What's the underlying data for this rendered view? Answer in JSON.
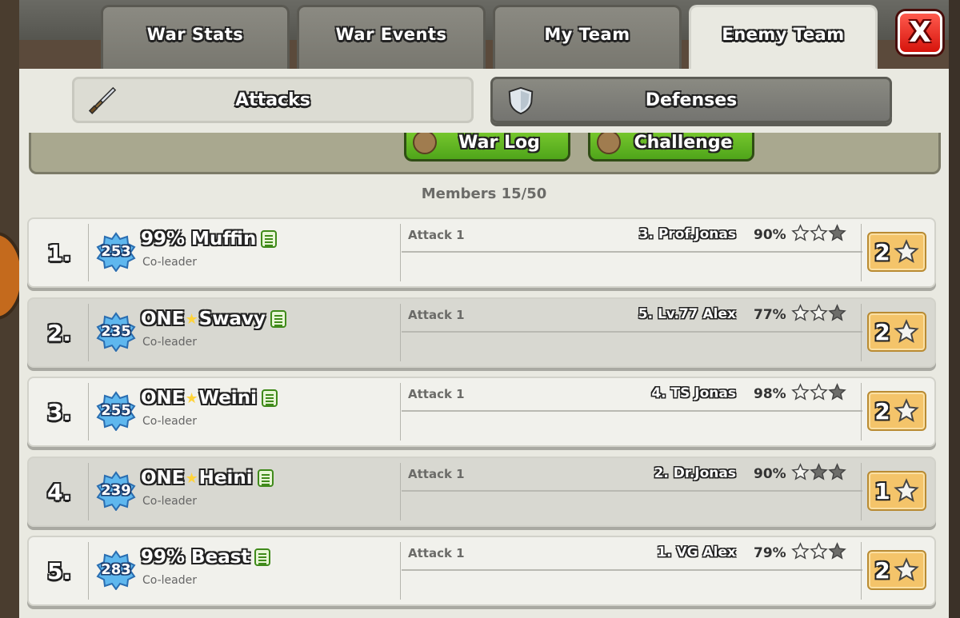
{
  "tabs": [
    {
      "label": "War Stats",
      "active": false
    },
    {
      "label": "War Events",
      "active": false
    },
    {
      "label": "My Team",
      "active": false
    },
    {
      "label": "Enemy Team",
      "active": true
    }
  ],
  "close_label": "X",
  "subtabs": {
    "attacks": {
      "label": "Attacks",
      "icon": "sword-icon"
    },
    "defenses": {
      "label": "Defenses",
      "icon": "shield-icon"
    }
  },
  "clan_buttons": {
    "war_log": "War Log",
    "challenge": "Challenge"
  },
  "members_count": "Members 15/50",
  "colors": {
    "accent_gold": "#f4c46a",
    "green_button": "#6cc52a",
    "close_red": "#e0231a"
  },
  "members": [
    {
      "rank": "1.",
      "level": "253",
      "name_parts": [
        "99% Muffin"
      ],
      "role": "Co-leader",
      "attack_label": "Attack 1",
      "target": "3. Prof.Jonas",
      "percent": "90%",
      "stars_earned": 2,
      "total_stars": "2"
    },
    {
      "rank": "2.",
      "level": "235",
      "name_parts": [
        "ONE",
        "Swavy"
      ],
      "role": "Co-leader",
      "attack_label": "Attack 1",
      "target": "5. Lv.77 Alex",
      "percent": "77%",
      "stars_earned": 2,
      "total_stars": "2"
    },
    {
      "rank": "3.",
      "level": "255",
      "name_parts": [
        "ONE",
        "Weini"
      ],
      "role": "Co-leader",
      "attack_label": "Attack 1",
      "target": "4. TS Jonas",
      "percent": "98%",
      "stars_earned": 2,
      "total_stars": "2"
    },
    {
      "rank": "4.",
      "level": "239",
      "name_parts": [
        "ONE",
        "Heini"
      ],
      "role": "Co-leader",
      "attack_label": "Attack 1",
      "target": "2. Dr.Jonas",
      "percent": "90%",
      "stars_earned": 1,
      "total_stars": "1"
    },
    {
      "rank": "5.",
      "level": "283",
      "name_parts": [
        "99% Beast"
      ],
      "role": "Co-leader",
      "attack_label": "Attack 1",
      "target": "1. VG Alex",
      "percent": "79%",
      "stars_earned": 2,
      "total_stars": "2"
    }
  ]
}
